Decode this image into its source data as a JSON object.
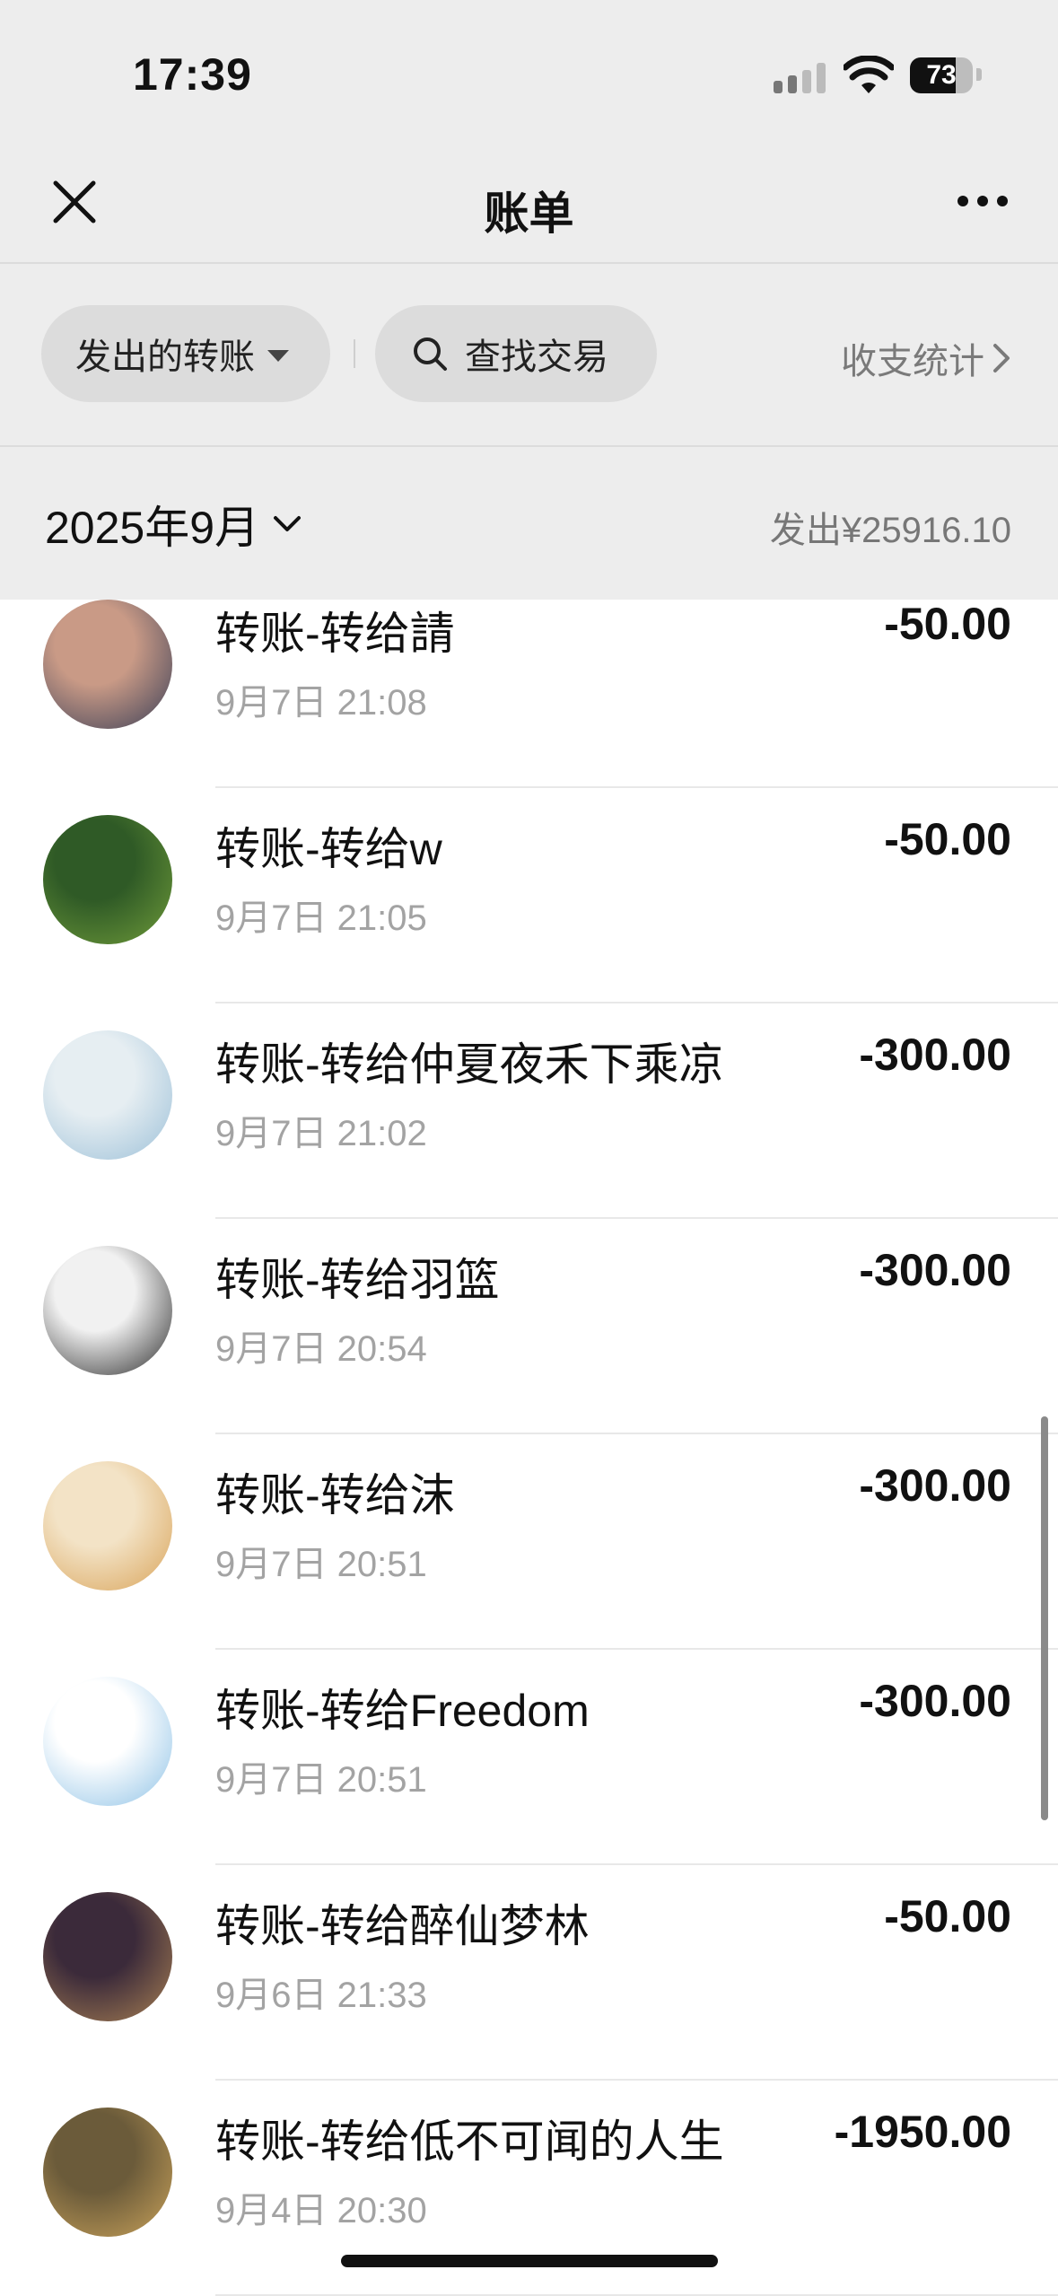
{
  "status_bar": {
    "time": "17:39",
    "battery": "73"
  },
  "nav": {
    "title": "账单",
    "close_icon": "close-icon",
    "more_icon": "more-icon"
  },
  "filters": {
    "sent_label": "发出的转账",
    "search_label": "查找交易",
    "stats_label": "收支统计"
  },
  "month": {
    "label": "2025年9月",
    "summary": "发出¥25916.10"
  },
  "transactions": [
    {
      "title": "转账-转给請",
      "time": "9月7日 21:08",
      "amount": "-50.00",
      "avatar_colors": [
        "#c99a86",
        "#3a3f57"
      ]
    },
    {
      "title": "转账-转给w",
      "time": "9月7日 21:05",
      "amount": "-50.00",
      "avatar_colors": [
        "#2f5a26",
        "#6f9b3a"
      ]
    },
    {
      "title": "转账-转给仲夏夜禾下乘凉",
      "time": "9月7日 21:02",
      "amount": "-300.00",
      "avatar_colors": [
        "#e6eef2",
        "#9cc0d8"
      ]
    },
    {
      "title": "转账-转给羽篮",
      "time": "9月7日 20:54",
      "amount": "-300.00",
      "avatar_colors": [
        "#f1f1f1",
        "#2b2b2b"
      ]
    },
    {
      "title": "转账-转给沫",
      "time": "9月7日 20:51",
      "amount": "-300.00",
      "avatar_colors": [
        "#f3e3c6",
        "#d9a45a"
      ]
    },
    {
      "title": "转账-转给Freedom",
      "time": "9月7日 20:51",
      "amount": "-300.00",
      "avatar_colors": [
        "#ffffff",
        "#8ec2e6"
      ]
    },
    {
      "title": "转账-转给醉仙梦林",
      "time": "9月6日 21:33",
      "amount": "-50.00",
      "avatar_colors": [
        "#3b2a3a",
        "#a88053"
      ]
    },
    {
      "title": "转账-转给低不可闻的人生",
      "time": "9月4日 20:30",
      "amount": "-1950.00",
      "avatar_colors": [
        "#6b5b3a",
        "#c9a25a"
      ]
    }
  ]
}
